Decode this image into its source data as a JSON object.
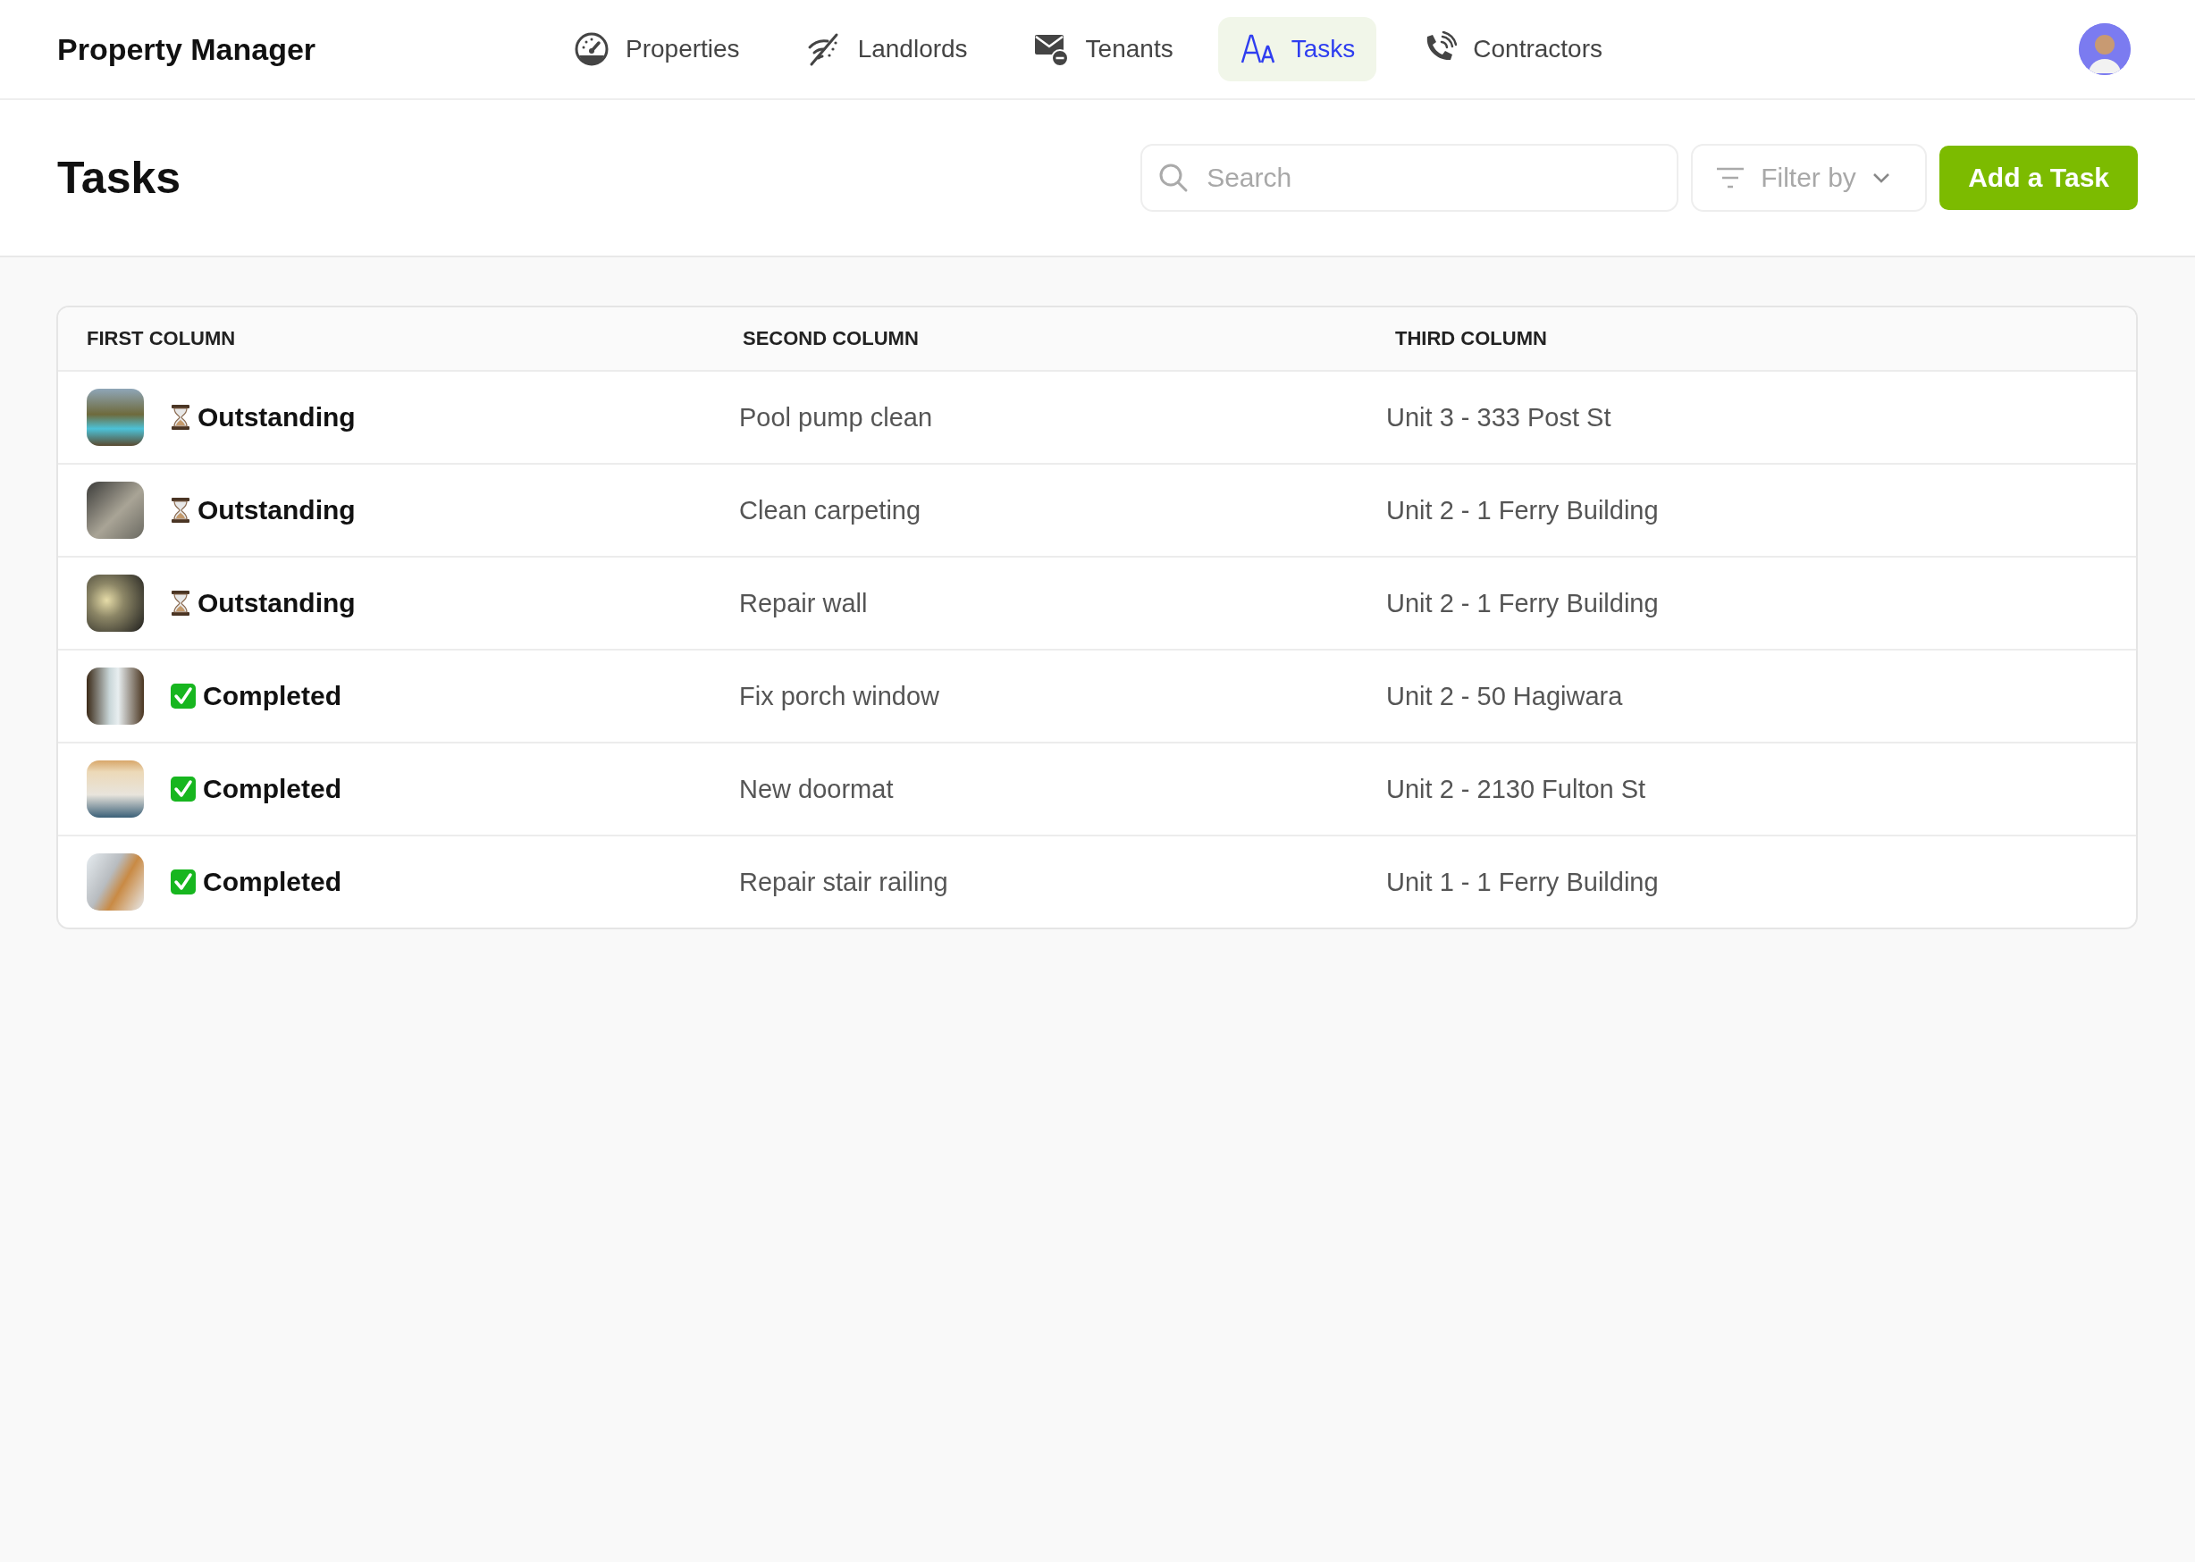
{
  "app": {
    "title": "Property Manager"
  },
  "nav": [
    {
      "label": "Properties",
      "selected": false
    },
    {
      "label": "Landlords",
      "selected": false
    },
    {
      "label": "Tenants",
      "selected": false
    },
    {
      "label": "Tasks",
      "selected": true
    },
    {
      "label": "Contractors",
      "selected": false
    }
  ],
  "page": {
    "title": "Tasks"
  },
  "search": {
    "placeholder": "Search"
  },
  "filter": {
    "label": "Filter by"
  },
  "add_button": {
    "label": "Add a Task"
  },
  "table": {
    "columns": [
      "FIRST COLUMN",
      "SECOND COLUMN",
      "THIRD COLUMN"
    ],
    "rows": [
      {
        "status": "Outstanding",
        "completed": false,
        "task": "Pool pump clean",
        "unit": "Unit 3 - 333 Post St"
      },
      {
        "status": "Outstanding",
        "completed": false,
        "task": "Clean carpeting",
        "unit": "Unit 2 - 1 Ferry Building"
      },
      {
        "status": "Outstanding",
        "completed": false,
        "task": "Repair wall",
        "unit": "Unit 2 - 1 Ferry Building"
      },
      {
        "status": "Completed",
        "completed": true,
        "task": "Fix porch window",
        "unit": "Unit 2 - 50 Hagiwara"
      },
      {
        "status": "Completed",
        "completed": true,
        "task": "New doormat",
        "unit": "Unit 2 - 2130 Fulton St"
      },
      {
        "status": "Completed",
        "completed": true,
        "task": "Repair stair railing",
        "unit": "Unit 1 - 1 Ferry Building"
      }
    ]
  }
}
